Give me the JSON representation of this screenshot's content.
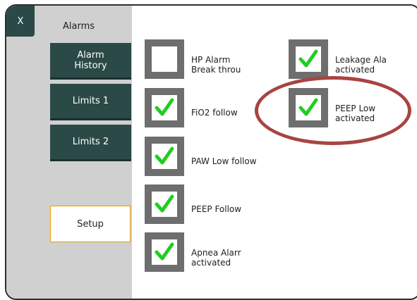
{
  "window": {
    "close_label": "X",
    "title": "Alarms"
  },
  "sidebar": {
    "items": [
      {
        "label": "Alarm\nHistory"
      },
      {
        "label": "Limits 1"
      },
      {
        "label": "Limits 2"
      }
    ],
    "setup_label": "Setup"
  },
  "options": [
    {
      "label": "HP Alarm\nBreak throu",
      "checked": false
    },
    {
      "label": "FiO2 follow",
      "checked": true
    },
    {
      "label": "PAW Low follow",
      "checked": true
    },
    {
      "label": "PEEP Follow",
      "checked": true
    },
    {
      "label": "Apnea Alarr\nactivated",
      "checked": true
    },
    {
      "label": "Leakage Ala\nactivated",
      "checked": true
    },
    {
      "label": "PEEP Low\nactivated",
      "checked": true
    }
  ],
  "colors": {
    "button_bg": "#2b4a47",
    "sidebar_bg": "#d0d0d0",
    "checkbox_frame": "#6e6e6e",
    "checkmark": "#22cc22",
    "highlight_ellipse": "#a84442",
    "setup_border": "#e8a000"
  },
  "icons": {
    "checkbox_checked": "checkmark-icon"
  }
}
